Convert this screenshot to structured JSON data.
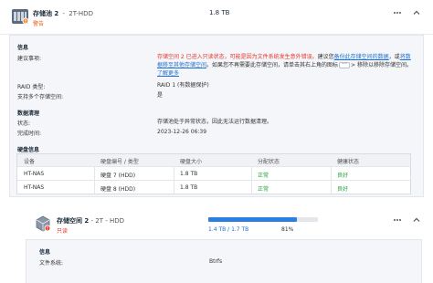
{
  "pool": {
    "name": "存储池 2",
    "separator": " - ",
    "subtitle": "2T-HDD",
    "status": "警告",
    "size": "1.8 TB"
  },
  "details": {
    "info_heading": "信息",
    "suggestion_label": "建议事项:",
    "suggestion_red_1": "存储空间 2 已进入只读状态，可能是因为文件系统发生意外错误。",
    "suggestion_mid": "建议您",
    "suggestion_link_1": "备份此存储空间的数据",
    "suggestion_mid_2": "，或",
    "suggestion_link_2_a": "将数",
    "suggestion_link_2_b": "据移至其他存储空间",
    "suggestion_mid_3": "。如果您不再需要此存储空间，请单击其右上角的图标",
    "suggestion_more": "···",
    "suggestion_tail": "> 移除以移除存储空间。",
    "learn_more": "了解更多",
    "raid_label": "RAID 类型:",
    "raid_value": "RAID 1 (有数据保护)",
    "multi_label": "支持多个存储空间:",
    "multi_value": "是",
    "scrub_heading": "数据清理",
    "state_label": "状态:",
    "state_value": "存储池处于异常状态，因此无法运行数据清理。",
    "done_label": "完成时间:",
    "done_value": "2023-12-26 06:39",
    "disk_heading": "硬盘信息"
  },
  "disk_table": {
    "headers": [
      "设备",
      "硬盘编号 / 类型",
      "硬盘大小",
      "分配状态",
      "健康状态"
    ],
    "rows": [
      [
        "HT-NAS",
        "硬盘 7 (HDD)",
        "1.8 TB",
        "正常",
        "良好"
      ],
      [
        "HT-NAS",
        "硬盘 8 (HDD)",
        "1.8 TB",
        "正常",
        "良好"
      ]
    ]
  },
  "volume": {
    "name": "存储空间 2",
    "separator": " - ",
    "subtitle": "2T - HDD",
    "status": "只读",
    "usage": "1.4 TB / 1.7 TB",
    "percent": "81%",
    "used_fraction": 0.81,
    "info_heading": "信息",
    "fs_label": "文件系统:",
    "fs_value": "Btrfs"
  },
  "colors": {
    "accent": "#2a7fe0",
    "warning": "#e8590c",
    "error": "#e5362d",
    "ok": "#22a13a"
  },
  "icons": {
    "pool": "storage-pool-icon",
    "volume": "volume-cube-icon",
    "menu": "more-vertical-icon",
    "collapse": "chevron-up-icon",
    "expand": "chevron-down-icon"
  }
}
